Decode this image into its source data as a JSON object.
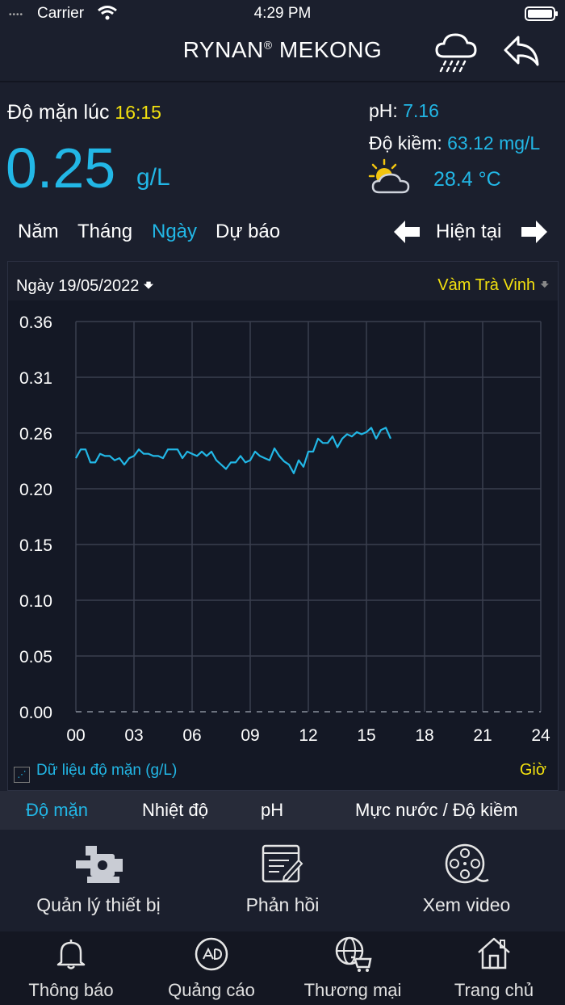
{
  "status": {
    "carrier": "Carrier",
    "time": "4:29 PM"
  },
  "header": {
    "title": "RYNAN",
    "title_mark": "®",
    "title_rest": " MEKONG"
  },
  "salinity": {
    "label": "Độ mặn lúc",
    "time": "16:15",
    "value": "0.25",
    "unit": "g/L"
  },
  "ph": {
    "label": "pH:",
    "value": "7.16"
  },
  "alkalinity": {
    "label": "Độ kiềm:",
    "value": "63.12 mg/L"
  },
  "weather": {
    "icon": "sun-cloud-icon",
    "temp": "28.4 °C"
  },
  "period_tabs": [
    {
      "label": "Năm",
      "active": false
    },
    {
      "label": "Tháng",
      "active": false
    },
    {
      "label": "Ngày",
      "active": true
    },
    {
      "label": "Dự báo",
      "active": false
    }
  ],
  "nav": {
    "current_label": "Hiện tại"
  },
  "chart_header": {
    "date": "Ngày 19/05/2022",
    "station": "Vàm Trà Vinh"
  },
  "chart_data": {
    "type": "line",
    "xlabel": "Giờ",
    "x_ticks": [
      "00",
      "03",
      "06",
      "09",
      "12",
      "15",
      "18",
      "21",
      "24"
    ],
    "y_ticks": [
      "0.36",
      "0.31",
      "0.26",
      "0.20",
      "0.15",
      "0.10",
      "0.05",
      "0.00"
    ],
    "xlim": [
      0,
      24
    ],
    "ylim": [
      0,
      0.36
    ],
    "legend": "Dữ liệu độ mặn (g/L)",
    "series": [
      {
        "name": "Dữ liệu độ mặn (g/L)",
        "color": "#22b7e6",
        "x": [
          0,
          0.25,
          0.5,
          0.75,
          1,
          1.25,
          1.5,
          1.75,
          2,
          2.25,
          2.5,
          2.75,
          3,
          3.25,
          3.5,
          3.75,
          4,
          4.25,
          4.5,
          4.75,
          5,
          5.25,
          5.5,
          5.75,
          6,
          6.25,
          6.5,
          6.75,
          7,
          7.25,
          7.5,
          7.75,
          8,
          8.25,
          8.5,
          8.75,
          9,
          9.25,
          9.5,
          9.75,
          10,
          10.25,
          10.5,
          10.75,
          11,
          11.25,
          11.5,
          11.75,
          12,
          12.25,
          12.5,
          12.75,
          13,
          13.25,
          13.5,
          13.75,
          14,
          14.25,
          14.5,
          14.75,
          15,
          15.25,
          15.5,
          15.75,
          16,
          16.25
        ],
        "y": [
          0.234,
          0.242,
          0.242,
          0.23,
          0.23,
          0.238,
          0.236,
          0.236,
          0.232,
          0.234,
          0.228,
          0.234,
          0.236,
          0.242,
          0.238,
          0.238,
          0.236,
          0.236,
          0.234,
          0.242,
          0.242,
          0.242,
          0.234,
          0.24,
          0.238,
          0.236,
          0.24,
          0.236,
          0.24,
          0.232,
          0.228,
          0.224,
          0.23,
          0.23,
          0.236,
          0.23,
          0.232,
          0.24,
          0.236,
          0.234,
          0.232,
          0.243,
          0.236,
          0.231,
          0.228,
          0.22,
          0.232,
          0.226,
          0.24,
          0.24,
          0.252,
          0.248,
          0.248,
          0.254,
          0.244,
          0.252,
          0.256,
          0.254,
          0.258,
          0.256,
          0.258,
          0.262,
          0.252,
          0.26,
          0.262,
          0.252
        ]
      }
    ]
  },
  "metric_tabs": [
    {
      "label": "Độ mặn",
      "active": true
    },
    {
      "label": "Nhiệt độ",
      "active": false
    },
    {
      "label": "pH",
      "active": false
    },
    {
      "label": "Mực nước / Độ kiềm",
      "active": false
    }
  ],
  "actions": [
    {
      "label": "Quản lý thiết bị",
      "icon": "pump-icon"
    },
    {
      "label": "Phản hồi",
      "icon": "feedback-icon"
    },
    {
      "label": "Xem video",
      "icon": "film-reel-icon"
    }
  ],
  "bottom_nav": [
    {
      "label": "Thông báo",
      "icon": "bell-icon"
    },
    {
      "label": "Quảng cáo",
      "icon": "ads-icon"
    },
    {
      "label": "Thương mại",
      "icon": "globe-cart-icon"
    },
    {
      "label": "Trang chủ",
      "icon": "home-icon"
    }
  ]
}
